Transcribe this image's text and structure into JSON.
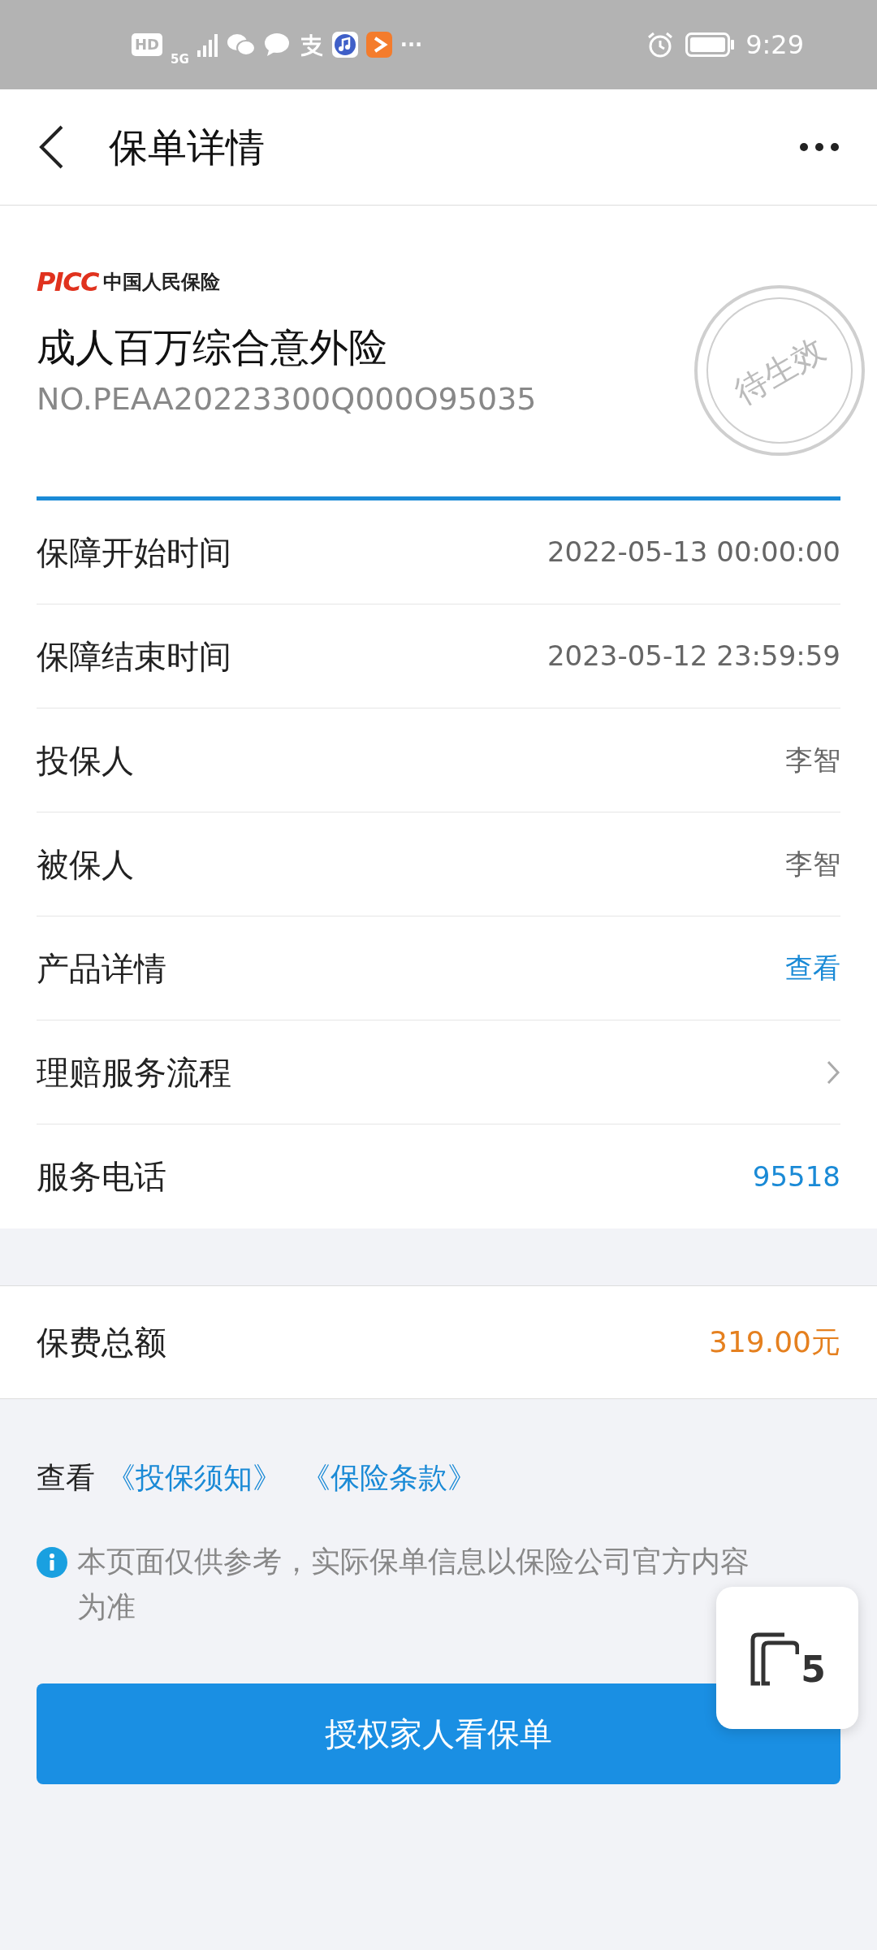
{
  "status_bar": {
    "hd": "HD",
    "network": "5G",
    "more": "···",
    "time": "9:29"
  },
  "header": {
    "title": "保单详情"
  },
  "policy": {
    "logo_mark": "PICC",
    "logo_name": "中国人民保险",
    "product": "成人百万综合意外险",
    "number": "NO.PEAA20223300Q000O95035",
    "stamp": "待生效"
  },
  "rows": [
    {
      "label": "保障开始时间",
      "kind": "text",
      "value": "2022-05-13 00:00:00"
    },
    {
      "label": "保障结束时间",
      "kind": "text",
      "value": "2023-05-12 23:59:59"
    },
    {
      "label": "投保人",
      "kind": "text",
      "value": "李智"
    },
    {
      "label": "被保人",
      "kind": "text",
      "value": "李智"
    },
    {
      "label": "产品详情",
      "kind": "link",
      "value": "查看"
    },
    {
      "label": "理赔服务流程",
      "kind": "chevron"
    },
    {
      "label": "服务电话",
      "kind": "link",
      "value": "95518"
    }
  ],
  "premium": {
    "label": "保费总额",
    "value": "319.00元"
  },
  "documents": {
    "prefix": "查看",
    "links": [
      "《投保须知》",
      "《保险条款》"
    ]
  },
  "notice": "本页面仅供参考，实际保单信息以保险公司官方内容为准",
  "primary_button": "授权家人看保单",
  "floating_widget": {
    "count": "5"
  }
}
